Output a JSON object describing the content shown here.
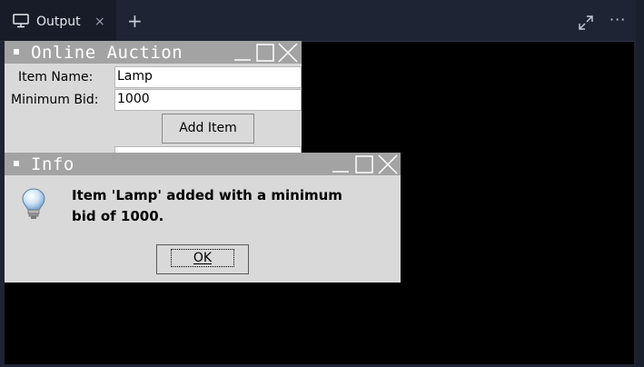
{
  "tabs": {
    "active_label": "Output",
    "close_glyph": "×",
    "add_glyph": "+",
    "more_glyph": "···"
  },
  "auction_window": {
    "title": "Online Auction",
    "item_name_label": "Item Name:",
    "item_name_value": "Lamp",
    "min_bid_label": "Minimum Bid:",
    "min_bid_value": "1000",
    "add_button_label": "Add Item"
  },
  "info_dialog": {
    "title": "Info",
    "message_line1": "Item 'Lamp' added with a minimum",
    "message_line2": "bid of 1000.",
    "ok_label": "OK",
    "icon": "lightbulb-icon"
  },
  "colors": {
    "titlebar": "#a3a3a3",
    "window_bg": "#d9d9d9",
    "panel_bg": "#1e2433",
    "canvas_bg": "#000000"
  }
}
